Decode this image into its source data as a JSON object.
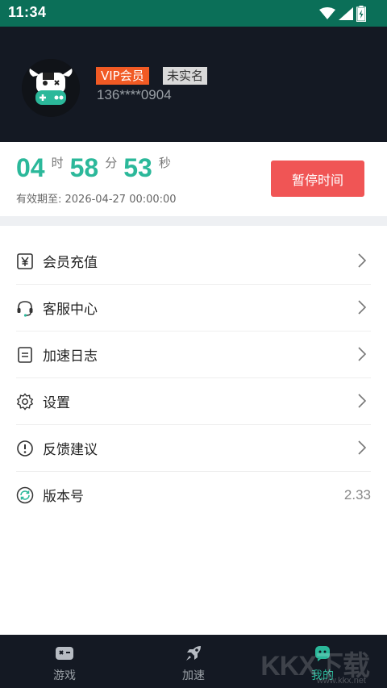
{
  "status_bar": {
    "time": "11:34"
  },
  "profile": {
    "vip_label": "VIP会员",
    "realname_label": "未实名",
    "phone": "136****0904"
  },
  "timer": {
    "hours": "04",
    "hours_unit": "时",
    "minutes": "58",
    "minutes_unit": "分",
    "seconds": "53",
    "seconds_unit": "秒",
    "expiry": "有效期至: 2026-04-27 00:00:00",
    "pause_label": "暂停时间"
  },
  "menu": {
    "items": [
      {
        "label": "会员充值",
        "icon": "yen-card-icon"
      },
      {
        "label": "客服中心",
        "icon": "headset-icon"
      },
      {
        "label": "加速日志",
        "icon": "document-icon"
      },
      {
        "label": "设置",
        "icon": "gear-icon"
      },
      {
        "label": "反馈建议",
        "icon": "exclamation-icon"
      },
      {
        "label": "版本号",
        "icon": "refresh-icon",
        "value": "2.33"
      }
    ]
  },
  "tabbar": {
    "tabs": [
      {
        "label": "游戏",
        "icon": "gamepad-icon"
      },
      {
        "label": "加速",
        "icon": "rocket-icon"
      },
      {
        "label": "我的",
        "icon": "profile-icon",
        "active": true
      }
    ]
  },
  "watermark": {
    "text": "KKX下载",
    "sub": "www.kkx.net"
  },
  "colors": {
    "accent": "#2bb89a",
    "pause": "#f05555",
    "vip": "#f15a24",
    "header": "#141923",
    "statusbar": "#0b6f58"
  }
}
